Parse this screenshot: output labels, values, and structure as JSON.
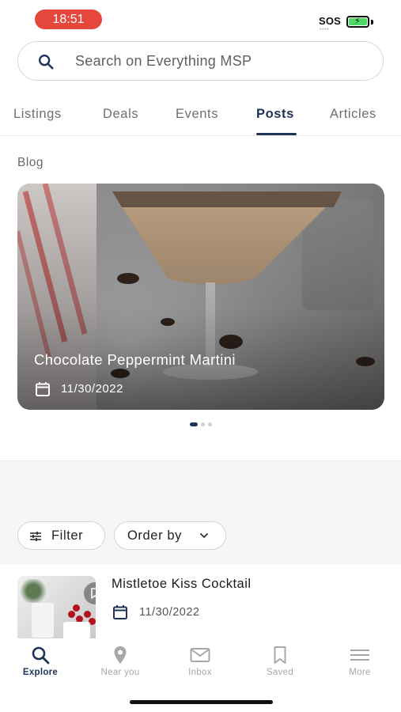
{
  "status_bar": {
    "time": "18:51",
    "carrier": "SOS",
    "dots": "••••"
  },
  "search": {
    "placeholder": "Search on Everything MSP"
  },
  "tabs": [
    {
      "label": "Listings",
      "active": false
    },
    {
      "label": "Deals",
      "active": false
    },
    {
      "label": "Events",
      "active": false
    },
    {
      "label": "Posts",
      "active": true
    },
    {
      "label": "Articles",
      "active": false
    }
  ],
  "blog": {
    "section_title": "Blog",
    "featured": {
      "title": "Chocolate Peppermint Martini",
      "date": "11/30/2022"
    },
    "pager": {
      "total": 3,
      "active_index": 0
    }
  },
  "filters": {
    "filter_label": "Filter",
    "order_label": "Order by"
  },
  "posts": [
    {
      "title": "Mistletoe Kiss Cocktail",
      "date": "11/30/2022"
    }
  ],
  "bottom_nav": [
    {
      "label": "Explore",
      "icon": "search-icon",
      "active": true
    },
    {
      "label": "Near you",
      "icon": "location-pin-icon",
      "active": false
    },
    {
      "label": "Inbox",
      "icon": "mail-icon",
      "active": false
    },
    {
      "label": "Saved",
      "icon": "bookmark-icon",
      "active": false
    },
    {
      "label": "More",
      "icon": "menu-icon",
      "active": false
    }
  ],
  "colors": {
    "accent": "#1e3358",
    "time_pill": "#e5473d",
    "battery": "#4cd964"
  }
}
